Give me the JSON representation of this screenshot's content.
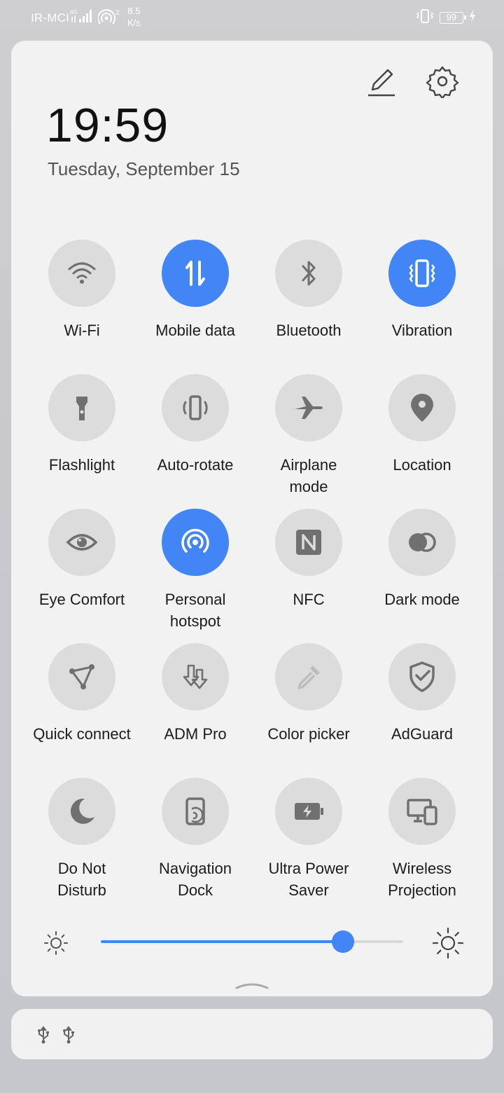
{
  "status_bar": {
    "carrier": "IR-MCI",
    "network_type": "4G",
    "hotspot_clients": "2",
    "speed_value": "8.5",
    "speed_unit": "K/s",
    "battery": "99"
  },
  "header": {
    "time": "19:59",
    "date": "Tuesday, September 15",
    "edit_icon": "pencil-icon",
    "settings_icon": "gear-icon"
  },
  "tiles": [
    {
      "label": "Wi-Fi",
      "icon": "wifi-icon",
      "active": false
    },
    {
      "label": "Mobile data",
      "icon": "mobile-data-icon",
      "active": true
    },
    {
      "label": "Bluetooth",
      "icon": "bluetooth-icon",
      "active": false
    },
    {
      "label": "Vibration",
      "icon": "vibration-icon",
      "active": true
    },
    {
      "label": "Flashlight",
      "icon": "flashlight-icon",
      "active": false
    },
    {
      "label": "Auto-rotate",
      "icon": "auto-rotate-icon",
      "active": false
    },
    {
      "label": "Airplane\nmode",
      "icon": "airplane-icon",
      "active": false
    },
    {
      "label": "Location",
      "icon": "location-pin-icon",
      "active": false
    },
    {
      "label": "Eye Comfort",
      "icon": "eye-icon",
      "active": false
    },
    {
      "label": "Personal\nhotspot",
      "icon": "hotspot-icon",
      "active": true
    },
    {
      "label": "NFC",
      "icon": "nfc-icon",
      "active": false
    },
    {
      "label": "Dark mode",
      "icon": "dark-mode-icon",
      "active": false
    },
    {
      "label": "Quick connect",
      "icon": "quick-connect-icon",
      "active": false
    },
    {
      "label": "ADM Pro",
      "icon": "adm-download-icon",
      "active": false
    },
    {
      "label": "Color picker",
      "icon": "eyedropper-icon",
      "active": false
    },
    {
      "label": "AdGuard",
      "icon": "shield-check-icon",
      "active": false
    },
    {
      "label": "Do Not\nDisturb",
      "icon": "moon-icon",
      "active": false
    },
    {
      "label": "Navigation\nDock",
      "icon": "navigation-dock-icon",
      "active": false
    },
    {
      "label": "Ultra Power\nSaver",
      "icon": "battery-bolt-icon",
      "active": false
    },
    {
      "label": "Wireless\nProjection",
      "icon": "projection-icon",
      "active": false
    }
  ],
  "brightness": {
    "level_fraction": 0.8
  },
  "colors": {
    "accent": "#4285f4",
    "tile_off": "#dcdcdc",
    "icon_off": "#707070",
    "panel": "#f2f2f2"
  },
  "notification": {
    "icons": [
      "usb-icon",
      "usb-icon"
    ]
  }
}
